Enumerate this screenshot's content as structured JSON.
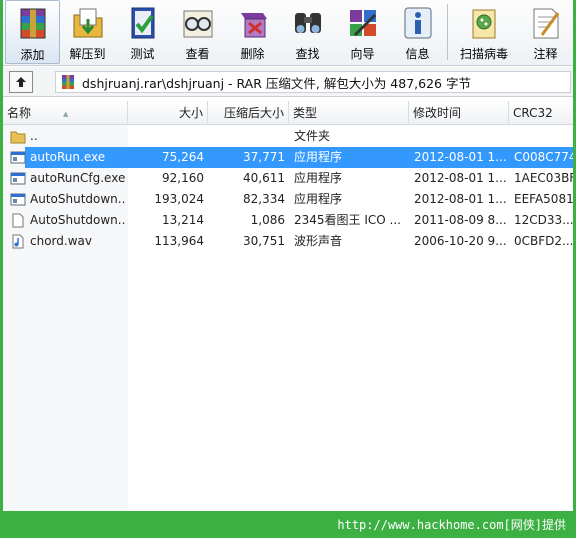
{
  "toolbar": {
    "buttons": [
      {
        "label": "添加",
        "icon": "add-archive-icon"
      },
      {
        "label": "解压到",
        "icon": "extract-to-icon"
      },
      {
        "label": "测试",
        "icon": "test-icon"
      },
      {
        "label": "查看",
        "icon": "view-icon"
      },
      {
        "label": "删除",
        "icon": "delete-icon"
      },
      {
        "label": "查找",
        "icon": "find-icon"
      },
      {
        "label": "向导",
        "icon": "wizard-icon"
      },
      {
        "label": "信息",
        "icon": "info-icon"
      },
      {
        "label": "扫描病毒",
        "icon": "virus-scan-icon"
      },
      {
        "label": "注释",
        "icon": "comment-icon"
      }
    ]
  },
  "address": {
    "path": "dshjruanj.rar\\dshjruanj - RAR 压缩文件, 解包大小为 487,626 字节"
  },
  "list": {
    "columns": [
      "名称",
      "大小",
      "压缩后大小",
      "类型",
      "修改时间",
      "CRC32"
    ],
    "rows": [
      {
        "name": "..",
        "size": "",
        "packed": "",
        "type": "文件夹",
        "modified": "",
        "crc": "",
        "icon": "folder-up-icon"
      },
      {
        "name": "autoRun.exe",
        "size": "75,264",
        "packed": "37,771",
        "type": "应用程序",
        "modified": "2012-08-01 1...",
        "crc": "C008C774",
        "icon": "exe-icon"
      },
      {
        "name": "autoRunCfg.exe",
        "size": "92,160",
        "packed": "40,611",
        "type": "应用程序",
        "modified": "2012-08-01 1...",
        "crc": "1AEC03BF",
        "icon": "exe-icon"
      },
      {
        "name": "AutoShutdown...",
        "size": "193,024",
        "packed": "82,334",
        "type": "应用程序",
        "modified": "2012-08-01 1...",
        "crc": "EEFA5081",
        "icon": "exe-icon"
      },
      {
        "name": "AutoShutdown...",
        "size": "13,214",
        "packed": "1,086",
        "type": "2345看图王 ICO ...",
        "modified": "2011-08-09 8...",
        "crc": "12CD33...",
        "icon": "ico-file-icon"
      },
      {
        "name": "chord.wav",
        "size": "113,964",
        "packed": "30,751",
        "type": "波形声音",
        "modified": "2006-10-20 9...",
        "crc": "0CBFD2...",
        "icon": "wav-file-icon"
      }
    ]
  },
  "status": {
    "url": "http://www.hackhome.com[网侠]提供"
  },
  "colors": {
    "selection": "#3399ff",
    "frame_green": "#3cb043"
  }
}
